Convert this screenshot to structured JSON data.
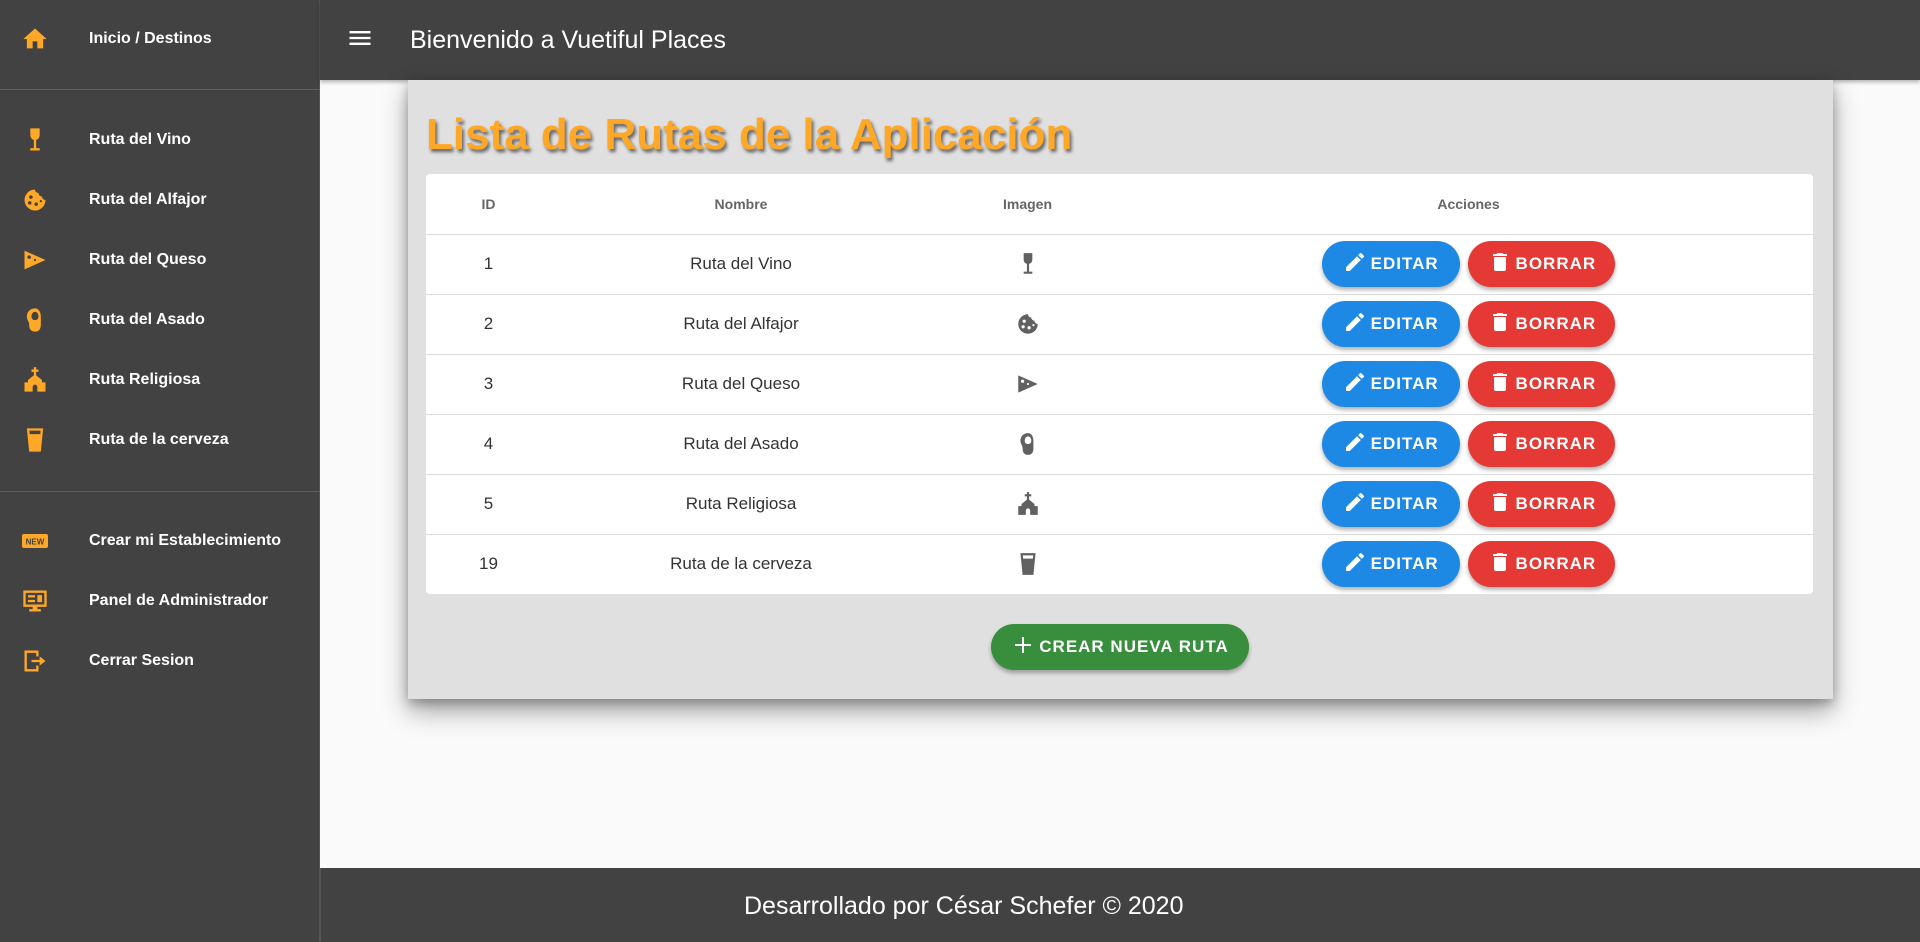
{
  "sidebar": {
    "home": {
      "label": "Inicio / Destinos",
      "icon": "home-icon"
    },
    "routes": [
      {
        "label": "Ruta del Vino",
        "icon": "wine-glass-icon"
      },
      {
        "label": "Ruta del Alfajor",
        "icon": "cookie-icon"
      },
      {
        "label": "Ruta del Queso",
        "icon": "cheese-icon"
      },
      {
        "label": "Ruta del Asado",
        "icon": "meat-icon"
      },
      {
        "label": "Ruta Religiosa",
        "icon": "church-icon"
      },
      {
        "label": "Ruta de la cerveza",
        "icon": "beer-glass-icon"
      }
    ],
    "actions": [
      {
        "label": "Crear mi Establecimiento",
        "icon": "new-badge-icon"
      },
      {
        "label": "Panel de Administrador",
        "icon": "monitor-dashboard-icon"
      },
      {
        "label": "Cerrar Sesion",
        "icon": "exit-icon"
      }
    ]
  },
  "header": {
    "title": "Bienvenido a Vuetiful Places",
    "menu_icon": "hamburger-menu-icon"
  },
  "main": {
    "title": "Lista de Rutas de la Aplicación",
    "table": {
      "headers": [
        "ID",
        "Nombre",
        "Imagen",
        "Acciones"
      ],
      "rows": [
        {
          "id": "1",
          "name": "Ruta del Vino",
          "icon": "wine-glass-icon"
        },
        {
          "id": "2",
          "name": "Ruta del Alfajor",
          "icon": "cookie-icon"
        },
        {
          "id": "3",
          "name": "Ruta del Queso",
          "icon": "cheese-icon"
        },
        {
          "id": "4",
          "name": "Ruta del Asado",
          "icon": "meat-icon"
        },
        {
          "id": "5",
          "name": "Ruta Religiosa",
          "icon": "church-icon"
        },
        {
          "id": "19",
          "name": "Ruta de la cerveza",
          "icon": "beer-glass-icon"
        }
      ],
      "edit_label": "EDITAR",
      "delete_label": "BORRAR"
    },
    "create_label": "CREAR NUEVA RUTA"
  },
  "footer": {
    "text": "Desarrollado por César Schefer © 2020"
  },
  "colors": {
    "accent": "#ffa726",
    "bar": "#424242",
    "edit": "#1e88e5",
    "delete": "#e53935",
    "create": "#388e3c"
  }
}
